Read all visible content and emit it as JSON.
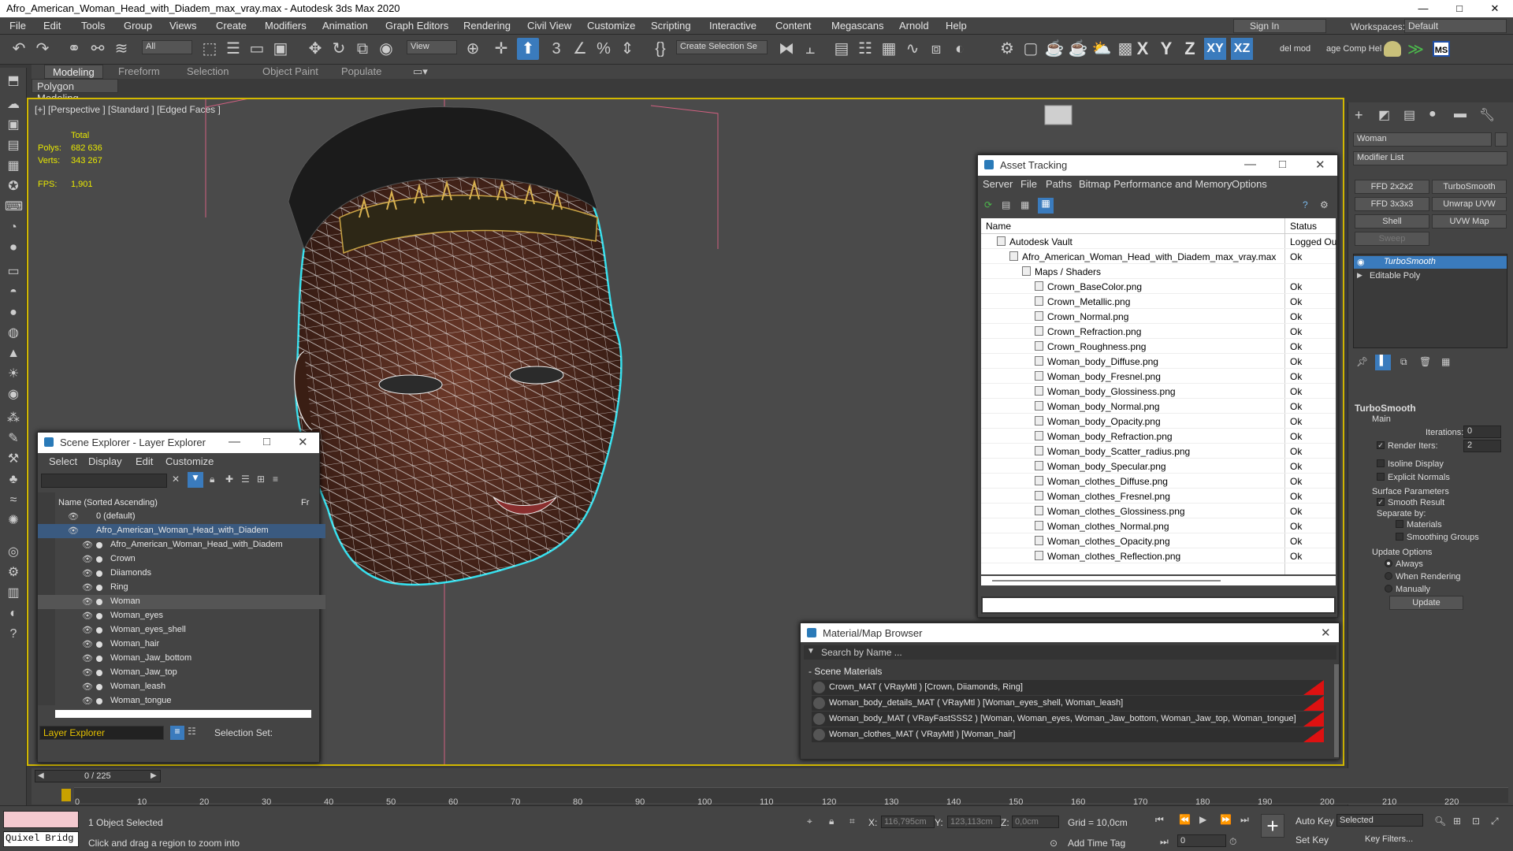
{
  "window": {
    "title": "Afro_American_Woman_Head_with_Diadem_max_vray.max - Autodesk 3ds Max 2020",
    "controls": [
      "—",
      "□",
      "✕"
    ]
  },
  "menu": [
    "File",
    "Edit",
    "Tools",
    "Group",
    "Views",
    "Create",
    "Modifiers",
    "Animation",
    "Graph Editors",
    "Rendering",
    "Civil View",
    "Customize",
    "Scripting",
    "Interactive",
    "Content",
    "Megascans",
    "Arnold",
    "Help"
  ],
  "account": {
    "sign_in": "Sign In",
    "workspaces_label": "Workspaces:",
    "workspace": "Default"
  },
  "toolbar": {
    "filter": "All",
    "view": "View",
    "selection_set": "Create Selection Se",
    "axes": [
      "X",
      "Y",
      "Z",
      "XY",
      "XZ"
    ],
    "del_mod": "del mod",
    "comp_help": "age Comp Hel",
    "ms": "MS"
  },
  "ribbon": {
    "tabs": [
      "Modeling",
      "Freeform",
      "Selection",
      "Object Paint",
      "Populate"
    ],
    "active": "Modeling",
    "sub": "Polygon Modeling"
  },
  "viewport": {
    "label": "[+] [Perspective ] [Standard ] [Edged Faces ]",
    "stats": {
      "total": "Total",
      "polys_label": "Polys:",
      "polys": "682 636",
      "verts_label": "Verts:",
      "verts": "343 267",
      "fps_label": "FPS:",
      "fps": "1,901"
    }
  },
  "scene_explorer": {
    "title": "Scene Explorer - Layer Explorer",
    "menu": [
      "Select",
      "Display",
      "Edit",
      "Customize"
    ],
    "column": "Name (Sorted Ascending)",
    "column2": "Fr",
    "rows": [
      {
        "name": "0 (default)",
        "level": 0
      },
      {
        "name": "Afro_American_Woman_Head_with_Diadem",
        "level": 0
      },
      {
        "name": "Afro_American_Woman_Head_with_Diadem",
        "level": 1
      },
      {
        "name": "Crown",
        "level": 1
      },
      {
        "name": "Diiamonds",
        "level": 1
      },
      {
        "name": "Ring",
        "level": 1
      },
      {
        "name": "Woman",
        "level": 1
      },
      {
        "name": "Woman_eyes",
        "level": 1
      },
      {
        "name": "Woman_eyes_shell",
        "level": 1
      },
      {
        "name": "Woman_hair",
        "level": 1
      },
      {
        "name": "Woman_Jaw_bottom",
        "level": 1
      },
      {
        "name": "Woman_Jaw_top",
        "level": 1
      },
      {
        "name": "Woman_leash",
        "level": 1
      },
      {
        "name": "Woman_tongue",
        "level": 1
      }
    ],
    "footer_explorer": "Layer Explorer",
    "footer_selset": "Selection Set:"
  },
  "asset_tracking": {
    "title": "Asset Tracking",
    "menu": [
      "Server",
      "File",
      "Paths",
      "Bitmap Performance and Memory",
      "Options"
    ],
    "col_name": "Name",
    "col_status": "Status",
    "rows": [
      {
        "name": "Autodesk Vault",
        "status": "Logged Ou",
        "level": 0
      },
      {
        "name": "Afro_American_Woman_Head_with_Diadem_max_vray.max",
        "status": "Ok",
        "level": 1
      },
      {
        "name": "Maps / Shaders",
        "status": "",
        "level": 2
      },
      {
        "name": "Crown_BaseColor.png",
        "status": "Ok",
        "level": 3
      },
      {
        "name": "Crown_Metallic.png",
        "status": "Ok",
        "level": 3
      },
      {
        "name": "Crown_Normal.png",
        "status": "Ok",
        "level": 3
      },
      {
        "name": "Crown_Refraction.png",
        "status": "Ok",
        "level": 3
      },
      {
        "name": "Crown_Roughness.png",
        "status": "Ok",
        "level": 3
      },
      {
        "name": "Woman_body_Diffuse.png",
        "status": "Ok",
        "level": 3
      },
      {
        "name": "Woman_body_Fresnel.png",
        "status": "Ok",
        "level": 3
      },
      {
        "name": "Woman_body_Glossiness.png",
        "status": "Ok",
        "level": 3
      },
      {
        "name": "Woman_body_Normal.png",
        "status": "Ok",
        "level": 3
      },
      {
        "name": "Woman_body_Opacity.png",
        "status": "Ok",
        "level": 3
      },
      {
        "name": "Woman_body_Refraction.png",
        "status": "Ok",
        "level": 3
      },
      {
        "name": "Woman_body_Scatter_radius.png",
        "status": "Ok",
        "level": 3
      },
      {
        "name": "Woman_body_Specular.png",
        "status": "Ok",
        "level": 3
      },
      {
        "name": "Woman_clothes_Diffuse.png",
        "status": "Ok",
        "level": 3
      },
      {
        "name": "Woman_clothes_Fresnel.png",
        "status": "Ok",
        "level": 3
      },
      {
        "name": "Woman_clothes_Glossiness.png",
        "status": "Ok",
        "level": 3
      },
      {
        "name": "Woman_clothes_Normal.png",
        "status": "Ok",
        "level": 3
      },
      {
        "name": "Woman_clothes_Opacity.png",
        "status": "Ok",
        "level": 3
      },
      {
        "name": "Woman_clothes_Reflection.png",
        "status": "Ok",
        "level": 3
      }
    ]
  },
  "material_browser": {
    "title": "Material/Map Browser",
    "search_placeholder": "Search by Name ...",
    "section": "- Scene Materials",
    "rows": [
      "Crown_MAT  ( VRayMtl )  [Crown, Diiamonds, Ring]",
      "Woman_body_details_MAT  ( VRayMtl )  [Woman_eyes_shell, Woman_leash]",
      "Woman_body_MAT  ( VRayFastSSS2 )  [Woman, Woman_eyes, Woman_Jaw_bottom, Woman_Jaw_top, Woman_tongue]",
      "Woman_clothes_MAT  ( VRayMtl )  [Woman_hair]"
    ]
  },
  "command_panel": {
    "object_name": "Woman",
    "modifier_list": "Modifier List",
    "buttons": [
      "FFD 2x2x2",
      "TurboSmooth",
      "FFD 3x3x3",
      "Unwrap UVW",
      "Shell",
      "UVW Map",
      "Sweep"
    ],
    "stack": [
      "TurboSmooth",
      "Editable Poly"
    ],
    "rollout": "TurboSmooth",
    "main": "Main",
    "iterations_label": "Iterations:",
    "iterations": "0",
    "render_iters_label": "Render Iters:",
    "render_iters": "2",
    "isoline": "Isoline Display",
    "explicit": "Explicit Normals",
    "surface": "Surface Parameters",
    "smooth_result": "Smooth Result",
    "separate": "Separate by:",
    "materials": "Materials",
    "smoothing": "Smoothing Groups",
    "update_options": "Update Options",
    "always": "Always",
    "when_rendering": "When Rendering",
    "manually": "Manually",
    "update": "Update"
  },
  "timeline": {
    "frame": "0 / 225",
    "ticks": [
      "0",
      "10",
      "20",
      "30",
      "40",
      "50",
      "60",
      "70",
      "80",
      "90",
      "100",
      "110",
      "120",
      "130",
      "140",
      "150",
      "160",
      "170",
      "180",
      "190",
      "200",
      "210",
      "220"
    ]
  },
  "status": {
    "quixel": "Quixel Bridg",
    "selected": "1 Object Selected",
    "hint": "Click and drag a region to zoom into",
    "x_label": "X:",
    "x": "116,795cm",
    "y_label": "Y:",
    "y": "123,113cm",
    "z_label": "Z:",
    "z": "0,0cm",
    "grid": "Grid = 10,0cm",
    "add_time_tag": "Add Time Tag",
    "auto_key": "Auto Key",
    "set_key": "Set Key",
    "key_mode": "Selected",
    "key_filters": "Key Filters...",
    "frame_field": "0"
  }
}
